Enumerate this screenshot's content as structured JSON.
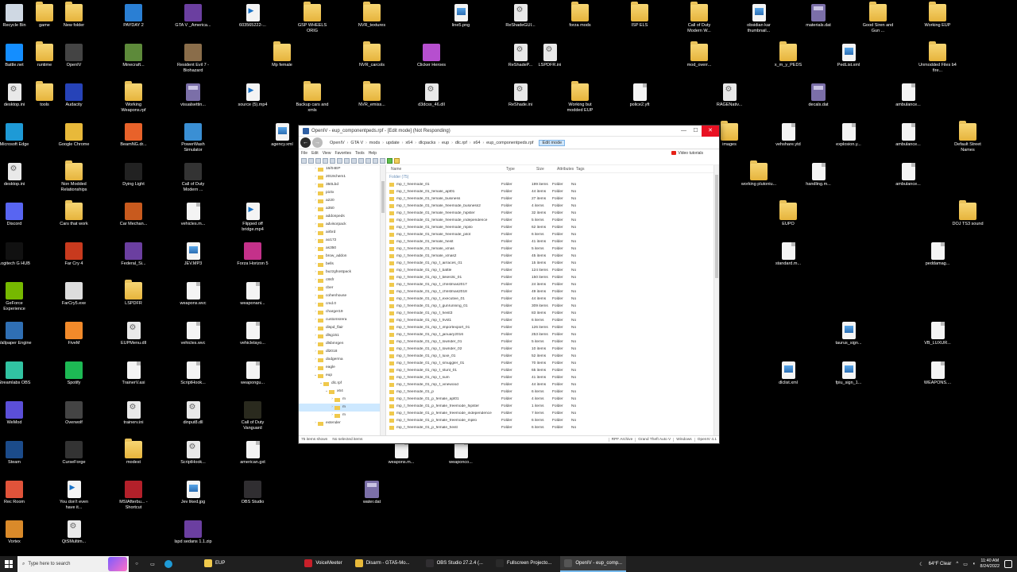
{
  "desktop": {
    "icons": [
      {
        "label": "Recycle Bin",
        "kind": "app",
        "color": "#cfd8e3"
      },
      {
        "label": "game",
        "kind": "folder"
      },
      {
        "label": "New folder",
        "kind": "folder"
      },
      {
        "label": "PAYDAY 2",
        "kind": "app",
        "color": "#2a7fd4"
      },
      {
        "label": "GTA V _America...",
        "kind": "app",
        "color": "#6b3fa0"
      },
      {
        "label": "603565222-...",
        "kind": "video"
      },
      {
        "label": "GSP WHEELS ORIG",
        "kind": "folder"
      },
      {
        "label": "NVR_textures",
        "kind": "folder"
      },
      {
        "label": "line5.png",
        "kind": "image"
      },
      {
        "label": "ReShadeGUI...",
        "kind": "dll"
      },
      {
        "label": "forza mods",
        "kind": "folder"
      },
      {
        "label": "ISP ELS",
        "kind": "folder"
      },
      {
        "label": "Call of Duty Modern W...",
        "kind": "folder"
      },
      {
        "label": "obsidian kar thumbnail...",
        "kind": "image"
      },
      {
        "label": "materials.dat",
        "kind": "dat"
      },
      {
        "label": "Good Siren and Gun ...",
        "kind": "folder"
      },
      {
        "label": "Working EUP",
        "kind": "folder"
      },
      {
        "label": "Battle.net",
        "kind": "app",
        "color": "#148eff"
      },
      {
        "label": "runtime",
        "kind": "folder"
      },
      {
        "label": "OpenIV",
        "kind": "app",
        "color": "#444"
      },
      {
        "label": "Minecraft...",
        "kind": "app",
        "color": "#5d8a3a"
      },
      {
        "label": "Resident Evil 7 - Biohazard",
        "kind": "app",
        "color": "#8a6d4a"
      },
      {
        "label": "Mp female",
        "kind": "folder"
      },
      {
        "label": "NVR_carcols",
        "kind": "folder"
      },
      {
        "label": "Clicker Heroes",
        "kind": "app",
        "color": "#b64fcf"
      },
      {
        "label": "ReShadeP...",
        "kind": "dll"
      },
      {
        "label": "LSPDFR.ini",
        "kind": "dll"
      },
      {
        "label": "mod_overr...",
        "kind": "folder"
      },
      {
        "label": "x_m_y_PEDS",
        "kind": "folder"
      },
      {
        "label": "PedList.xml",
        "kind": "image"
      },
      {
        "label": "Unmodded Files b4 fire...",
        "kind": "folder"
      },
      {
        "label": "desktop.ini",
        "kind": "dll"
      },
      {
        "label": "tools",
        "kind": "folder"
      },
      {
        "label": "Audacity",
        "kind": "app",
        "color": "#2643b8"
      },
      {
        "label": "Working Weapons.rpf",
        "kind": "folder"
      },
      {
        "label": "visualsettin...",
        "kind": "dat"
      },
      {
        "label": "source (5).mp4",
        "kind": "video"
      },
      {
        "label": "Backup cars and xmls",
        "kind": "folder"
      },
      {
        "label": "NVR_emiss...",
        "kind": "folder"
      },
      {
        "label": "d3dcsx_46.dll",
        "kind": "dll"
      },
      {
        "label": "ReShade.ini",
        "kind": "dll"
      },
      {
        "label": "Working but modded EUP",
        "kind": "folder"
      },
      {
        "label": "police2.yft",
        "kind": "file"
      },
      {
        "label": "RAGENativ...",
        "kind": "dll"
      },
      {
        "label": "decals.dat",
        "kind": "dat"
      },
      {
        "label": "ambulance...",
        "kind": "file"
      },
      {
        "label": "Microsoft Edge",
        "kind": "app",
        "color": "#1e9ad6"
      },
      {
        "label": "Google Chrome",
        "kind": "app",
        "color": "#e8b93a"
      },
      {
        "label": "BeamNG.dr...",
        "kind": "app",
        "color": "#e8622a"
      },
      {
        "label": "PowerWash Simulator",
        "kind": "app",
        "color": "#3a8fd4"
      },
      {
        "label": "agency.xml",
        "kind": "image"
      },
      {
        "label": "images",
        "kind": "folder"
      },
      {
        "label": "vehshare.ytd",
        "kind": "file"
      },
      {
        "label": "explosion.y...",
        "kind": "file"
      },
      {
        "label": "ambulance...",
        "kind": "file"
      },
      {
        "label": "Default Street Names",
        "kind": "folder"
      },
      {
        "label": "desktop.ini",
        "kind": "dll"
      },
      {
        "label": "Non Modded Relationships",
        "kind": "folder"
      },
      {
        "label": "Dying Light",
        "kind": "app",
        "color": "#222"
      },
      {
        "label": "Call of Duty Modern ...",
        "kind": "app",
        "color": "#333"
      },
      {
        "label": "working plutoniu...",
        "kind": "folder"
      },
      {
        "label": "handling.m...",
        "kind": "file"
      },
      {
        "label": "ambulance...",
        "kind": "file"
      },
      {
        "label": "Discord",
        "kind": "app",
        "color": "#5865f2"
      },
      {
        "label": "Cars that work",
        "kind": "folder"
      },
      {
        "label": "Car Mechan...",
        "kind": "app",
        "color": "#c85a1e"
      },
      {
        "label": "vehicles.m...",
        "kind": "file"
      },
      {
        "label": "Flipped off bridge.mp4",
        "kind": "video"
      },
      {
        "label": "EUPO",
        "kind": "folder"
      },
      {
        "label": "DOJ TS3 sound",
        "kind": "folder"
      },
      {
        "label": "Logitech G HUB",
        "kind": "app",
        "color": "#111"
      },
      {
        "label": "Far Cry 4",
        "kind": "app",
        "color": "#c83a1e"
      },
      {
        "label": "Federal_Si...",
        "kind": "app",
        "color": "#6b3fa0"
      },
      {
        "label": "JEV.MP3",
        "kind": "image"
      },
      {
        "label": "Forza Horizon 5",
        "kind": "app",
        "color": "#c4318a"
      },
      {
        "label": "standard.m...",
        "kind": "file"
      },
      {
        "label": "peddamag...",
        "kind": "file"
      },
      {
        "label": "GeForce Experience",
        "kind": "app",
        "color": "#76b900"
      },
      {
        "label": "FarCry5.exe",
        "kind": "app",
        "color": "#ddd"
      },
      {
        "label": "LSPDFR",
        "kind": "folder"
      },
      {
        "label": "weapons.wvc",
        "kind": "file"
      },
      {
        "label": "weaponani...",
        "kind": "file"
      },
      {
        "label": "Wallpaper Engine",
        "kind": "app",
        "color": "#2f6fb4"
      },
      {
        "label": "FiveM",
        "kind": "app",
        "color": "#f28a2a"
      },
      {
        "label": "EUPMenu.dll",
        "kind": "dll"
      },
      {
        "label": "vehicles.wvc",
        "kind": "file"
      },
      {
        "label": "vehiclelayo...",
        "kind": "file"
      },
      {
        "label": "taurus_sign...",
        "kind": "image"
      },
      {
        "label": "VB_LUXUR...",
        "kind": "file"
      },
      {
        "label": "Streamlabs OBS",
        "kind": "app",
        "color": "#31c3a2"
      },
      {
        "label": "Spotify",
        "kind": "app",
        "color": "#1db954"
      },
      {
        "label": "TrainerV.asi",
        "kind": "file"
      },
      {
        "label": "ScriptHook...",
        "kind": "file"
      },
      {
        "label": "weapongu...",
        "kind": "file"
      },
      {
        "label": "dlclist.xml",
        "kind": "image"
      },
      {
        "label": "fpiu_sign_1...",
        "kind": "image"
      },
      {
        "label": "WEAPONS....",
        "kind": "file"
      },
      {
        "label": "WeMod",
        "kind": "app",
        "color": "#5b4fd8"
      },
      {
        "label": "Overwolf",
        "kind": "app",
        "color": "#444"
      },
      {
        "label": "trainerv.ini",
        "kind": "dll"
      },
      {
        "label": "dinput8.dll",
        "kind": "dll"
      },
      {
        "label": "Call of Duty Vanguard",
        "kind": "app",
        "color": "#2a2a1e"
      },
      {
        "label": "Steam",
        "kind": "app",
        "color": "#1b4b8a"
      },
      {
        "label": "CurseForge",
        "kind": "app",
        "color": "#333"
      },
      {
        "label": "modest",
        "kind": "folder"
      },
      {
        "label": "ScriptHook...",
        "kind": "dll"
      },
      {
        "label": "american.gxt",
        "kind": "file"
      },
      {
        "label": "weapons.m...",
        "kind": "file"
      },
      {
        "label": "weaponco...",
        "kind": "file"
      },
      {
        "label": "Rec Room",
        "kind": "app",
        "color": "#e0533a"
      },
      {
        "label": "You don't even have it...",
        "kind": "video"
      },
      {
        "label": "MSIAfterbu... - Shortcut",
        "kind": "app",
        "color": "#b3202a"
      },
      {
        "label": "Jev liked.jpg",
        "kind": "image"
      },
      {
        "label": "OBS Studio",
        "kind": "app",
        "color": "#302e31"
      },
      {
        "label": "water.dat",
        "kind": "dat"
      },
      {
        "label": "Vortex",
        "kind": "app",
        "color": "#d98a2a"
      },
      {
        "label": "QtSMultim...",
        "kind": "dll"
      },
      {
        "label": "lspd sedans 1.1.zip",
        "kind": "app",
        "color": "#6b3fa0"
      }
    ]
  },
  "openiv": {
    "title": "OpenIV - eup_componentpeds.rpf - [Edit mode] (Not Responding)",
    "breadcrumbs": [
      "OpenIV",
      "GTA V",
      "mods",
      "update",
      "x64",
      "dlcpacks",
      "eup",
      "dlc.rpf",
      "x64",
      "eup_componentpeds.rpf"
    ],
    "edit_mode_label": "Edit mode",
    "menu": [
      "File",
      "Edit",
      "View",
      "Favorites",
      "Tools",
      "Help"
    ],
    "video_tutorials": "Video tutorials",
    "columns": {
      "name": "Name",
      "type": "Type",
      "size": "Size",
      "attributes": "Attributes",
      "tags": "Tags"
    },
    "group_label": "Folder (75)",
    "tree": [
      {
        "label": "16/04EP"
      },
      {
        "label": "2019chem1"
      },
      {
        "label": "350Lbd"
      },
      {
        "label": "p10x"
      },
      {
        "label": "a220"
      },
      {
        "label": "a350"
      },
      {
        "label": "addonpeds"
      },
      {
        "label": "advisorpack"
      },
      {
        "label": "airbrd"
      },
      {
        "label": "ao172"
      },
      {
        "label": "as350"
      },
      {
        "label": "brow_addon"
      },
      {
        "label": "bells"
      },
      {
        "label": "buzzghostpack"
      },
      {
        "label": "c8sfr"
      },
      {
        "label": "cber"
      },
      {
        "label": "cohenhouse"
      },
      {
        "label": "cmd.0"
      },
      {
        "label": "charger19"
      },
      {
        "label": "customsrera"
      },
      {
        "label": "dispd_flair"
      },
      {
        "label": "dlsg151"
      },
      {
        "label": "dlsbmrgen"
      },
      {
        "label": "dl2018"
      },
      {
        "label": "dodgerma"
      },
      {
        "label": "eagle"
      },
      {
        "label": "eup"
      },
      {
        "label": "dlc.rpf"
      },
      {
        "label": "x64"
      },
      {
        "label": "m"
      },
      {
        "label": "m"
      },
      {
        "label": "m"
      },
      {
        "label": "extender"
      }
    ],
    "rows": [
      {
        "name": "mp_f_freemode_01",
        "type": "Folder",
        "size": "199 items",
        "attr": "Folder",
        "tags": "No"
      },
      {
        "name": "mp_f_freemode_01_female_apt01",
        "type": "Folder",
        "size": "44 items",
        "attr": "Folder",
        "tags": "No"
      },
      {
        "name": "mp_f_freemode_01_female_business",
        "type": "Folder",
        "size": "27 items",
        "attr": "Folder",
        "tags": "No"
      },
      {
        "name": "mp_f_freemode_01_female_freemode_business2",
        "type": "Folder",
        "size": "4 items",
        "attr": "Folder",
        "tags": "No"
      },
      {
        "name": "mp_f_freemode_01_female_freemode_hipster",
        "type": "Folder",
        "size": "32 items",
        "attr": "Folder",
        "tags": "No"
      },
      {
        "name": "mp_f_freemode_01_female_freemode_independence",
        "type": "Folder",
        "size": "5 items",
        "attr": "Folder",
        "tags": "No"
      },
      {
        "name": "mp_f_freemode_01_female_freemode_mpilo",
        "type": "Folder",
        "size": "62 items",
        "attr": "Folder",
        "tags": "No"
      },
      {
        "name": "mp_f_freemode_01_female_freemode_pilot",
        "type": "Folder",
        "size": "6 items",
        "attr": "Folder",
        "tags": "No"
      },
      {
        "name": "mp_f_freemode_01_female_heist",
        "type": "Folder",
        "size": "41 items",
        "attr": "Folder",
        "tags": "No"
      },
      {
        "name": "mp_f_freemode_01_female_xmas",
        "type": "Folder",
        "size": "5 items",
        "attr": "Folder",
        "tags": "No"
      },
      {
        "name": "mp_f_freemode_01_female_xmas2",
        "type": "Folder",
        "size": "45 items",
        "attr": "Folder",
        "tags": "No"
      },
      {
        "name": "mp_f_freemode_01_mp_f_airraces_01",
        "type": "Folder",
        "size": "15 items",
        "attr": "Folder",
        "tags": "No"
      },
      {
        "name": "mp_f_freemode_01_mp_f_battle",
        "type": "Folder",
        "size": "124 items",
        "attr": "Folder",
        "tags": "No"
      },
      {
        "name": "mp_f_freemode_01_mp_f_bikerdlc_01",
        "type": "Folder",
        "size": "150 items",
        "attr": "Folder",
        "tags": "No"
      },
      {
        "name": "mp_f_freemode_01_mp_f_christmas2017",
        "type": "Folder",
        "size": "24 items",
        "attr": "Folder",
        "tags": "No"
      },
      {
        "name": "mp_f_freemode_01_mp_f_christmas2018",
        "type": "Folder",
        "size": "49 items",
        "attr": "Folder",
        "tags": "No"
      },
      {
        "name": "mp_f_freemode_01_mp_f_executive_01",
        "type": "Folder",
        "size": "44 items",
        "attr": "Folder",
        "tags": "No"
      },
      {
        "name": "mp_f_freemode_01_mp_f_gunrunning_01",
        "type": "Folder",
        "size": "309 items",
        "attr": "Folder",
        "tags": "No"
      },
      {
        "name": "mp_f_freemode_01_mp_f_heist3",
        "type": "Folder",
        "size": "83 items",
        "attr": "Folder",
        "tags": "No"
      },
      {
        "name": "mp_f_freemode_01_mp_f_hvst1",
        "type": "Folder",
        "size": "6 items",
        "attr": "Folder",
        "tags": "No"
      },
      {
        "name": "mp_f_freemode_01_mp_f_importexport_01",
        "type": "Folder",
        "size": "126 items",
        "attr": "Folder",
        "tags": "No"
      },
      {
        "name": "mp_f_freemode_01_mp_f_january2016",
        "type": "Folder",
        "size": "253 items",
        "attr": "Folder",
        "tags": "No"
      },
      {
        "name": "mp_f_freemode_01_mp_f_lowrider_01",
        "type": "Folder",
        "size": "5 items",
        "attr": "Folder",
        "tags": "No"
      },
      {
        "name": "mp_f_freemode_01_mp_f_lowrider_02",
        "type": "Folder",
        "size": "10 items",
        "attr": "Folder",
        "tags": "No"
      },
      {
        "name": "mp_f_freemode_01_mp_f_luxe_01",
        "type": "Folder",
        "size": "52 items",
        "attr": "Folder",
        "tags": "No"
      },
      {
        "name": "mp_f_freemode_01_mp_f_smuggler_01",
        "type": "Folder",
        "size": "70 items",
        "attr": "Folder",
        "tags": "No"
      },
      {
        "name": "mp_f_freemode_01_mp_f_stunt_01",
        "type": "Folder",
        "size": "65 items",
        "attr": "Folder",
        "tags": "No"
      },
      {
        "name": "mp_f_freemode_01_mp_f_sum",
        "type": "Folder",
        "size": "41 items",
        "attr": "Folder",
        "tags": "No"
      },
      {
        "name": "mp_f_freemode_01_mp_f_vinewood",
        "type": "Folder",
        "size": "44 items",
        "attr": "Folder",
        "tags": "No"
      },
      {
        "name": "mp_f_freemode_01_p",
        "type": "Folder",
        "size": "6 items",
        "attr": "Folder",
        "tags": "No"
      },
      {
        "name": "mp_f_freemode_01_p_female_apt01",
        "type": "Folder",
        "size": "4 items",
        "attr": "Folder",
        "tags": "No"
      },
      {
        "name": "mp_f_freemode_01_p_female_freemode_hipster",
        "type": "Folder",
        "size": "1 items",
        "attr": "Folder",
        "tags": "No"
      },
      {
        "name": "mp_f_freemode_01_p_female_freemode_independence",
        "type": "Folder",
        "size": "7 items",
        "attr": "Folder",
        "tags": "No"
      },
      {
        "name": "mp_f_freemode_01_p_female_freemode_mpilo",
        "type": "Folder",
        "size": "6 items",
        "attr": "Folder",
        "tags": "No"
      },
      {
        "name": "mp_f_freemode_01_p_female_heist",
        "type": "Folder",
        "size": "6 items",
        "attr": "Folder",
        "tags": "No"
      }
    ],
    "status": {
      "items": "75 items shown",
      "selection": "No selected items",
      "archive": "RPF Archive",
      "game": "Grand Theft Auto V",
      "platform": "Windows",
      "version": "OpenIV 4.1"
    }
  },
  "taskbar": {
    "search_placeholder": "Type here to search",
    "apps": [
      {
        "label": "EUP",
        "color": "#f0c94c",
        "active": false
      },
      {
        "label": "VoiceMeeter",
        "color": "#c8202a",
        "active": false
      },
      {
        "label": "Disarm - GTA5-Mo...",
        "color": "#e8b93a",
        "active": false
      },
      {
        "label": "OBS Studio 27.2.4 (...",
        "color": "#302e31",
        "active": false
      },
      {
        "label": "Fullscreen Projecto...",
        "color": "#2a2a2a",
        "active": false
      },
      {
        "label": "OpenIV - eup_comp...",
        "color": "#555",
        "active": true
      }
    ],
    "weather": "64°F  Clear",
    "time": "11:40 AM",
    "date": "8/24/2022"
  }
}
